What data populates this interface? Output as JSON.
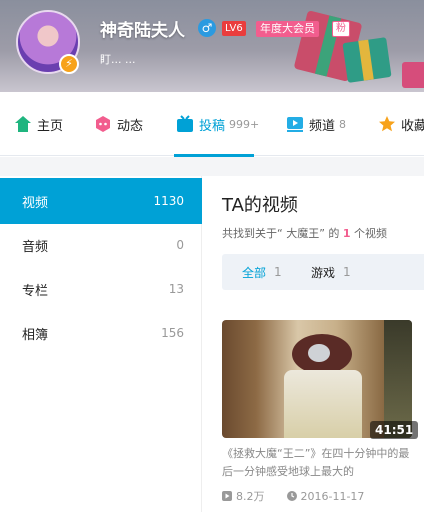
{
  "profile": {
    "username": "神奇陆夫人",
    "gender_icon": "♂",
    "level": "LV6",
    "vip": "年度大会员",
    "fan_badge": "粉",
    "sign": "盯... ..."
  },
  "nav": [
    {
      "label": "主页",
      "icon": "home-icon",
      "count": ""
    },
    {
      "label": "动态",
      "icon": "dynamic-icon",
      "count": ""
    },
    {
      "label": "投稿",
      "icon": "upload-icon",
      "count": "999+"
    },
    {
      "label": "频道",
      "icon": "channel-icon",
      "count": "8"
    },
    {
      "label": "收藏",
      "icon": "star-icon",
      "count": ""
    }
  ],
  "sidebar": [
    {
      "label": "视频",
      "count": "1130"
    },
    {
      "label": "音频",
      "count": "0"
    },
    {
      "label": "专栏",
      "count": "13"
    },
    {
      "label": "相簿",
      "count": "156"
    }
  ],
  "content": {
    "title": "TA的视频",
    "found_prefix": "共找到关于“ 大魔王” 的",
    "found_count": "1",
    "found_suffix": "个视频",
    "tabs": [
      {
        "label": "全部",
        "count": "1"
      },
      {
        "label": "游戏",
        "count": "1"
      }
    ]
  },
  "video": {
    "duration": "41:51",
    "title": "《拯救大魔“王二”》在四十分钟中的最后一分钟感受地球上最大的",
    "plays": "8.2万",
    "date": "2016-11-17"
  },
  "colors": {
    "accent": "#00a1d6",
    "pink": "#f25d8e"
  }
}
